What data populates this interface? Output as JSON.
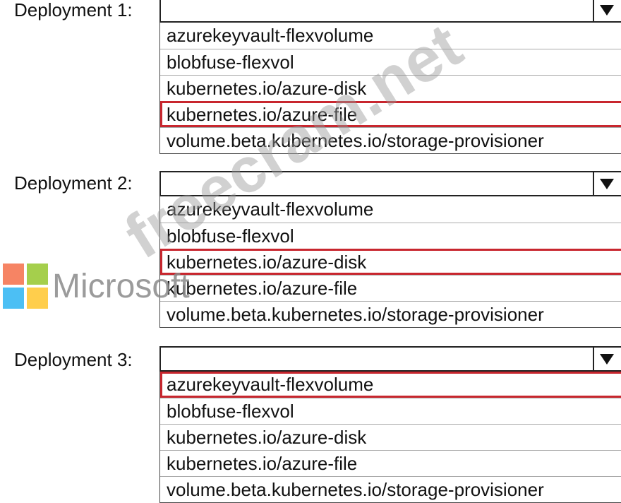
{
  "deployments": [
    {
      "label": "Deployment 1:",
      "selected_index": 3,
      "options": [
        "azurekeyvault-flexvolume",
        "blobfuse-flexvol",
        "kubernetes.io/azure-disk",
        "kubernetes.io/azure-file",
        "volume.beta.kubernetes.io/storage-provisioner"
      ]
    },
    {
      "label": "Deployment 2:",
      "selected_index": 2,
      "options": [
        "azurekeyvault-flexvolume",
        "blobfuse-flexvol",
        "kubernetes.io/azure-disk",
        "kubernetes.io/azure-file",
        "volume.beta.kubernetes.io/storage-provisioner"
      ]
    },
    {
      "label": "Deployment 3:",
      "selected_index": 0,
      "options": [
        "azurekeyvault-flexvolume",
        "blobfuse-flexvol",
        "kubernetes.io/azure-disk",
        "kubernetes.io/azure-file",
        "volume.beta.kubernetes.io/storage-provisioner"
      ]
    }
  ],
  "watermark": {
    "brand": "Microsoft",
    "site": "freecram.net",
    "logo_colors": [
      "#f25022",
      "#7fba00",
      "#00a4ef",
      "#ffb900"
    ]
  },
  "colors": {
    "selection_border": "#c8262e"
  }
}
